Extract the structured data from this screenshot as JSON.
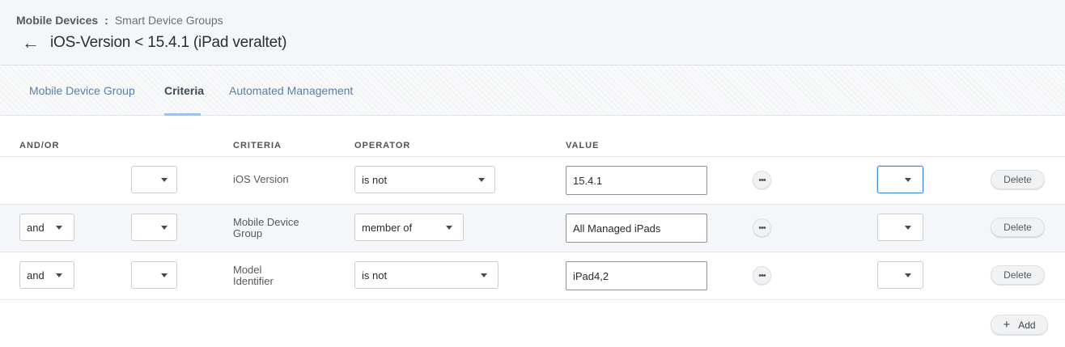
{
  "breadcrumb": {
    "root": "Mobile Devices",
    "separator": ":",
    "leaf": "Smart Device Groups"
  },
  "page": {
    "back_icon": "←",
    "title": "iOS-Version < 15.4.1 (iPad veraltet)"
  },
  "tabs": [
    {
      "label": "Mobile Device Group",
      "active": false
    },
    {
      "label": "Criteria",
      "active": true
    },
    {
      "label": "Automated Management",
      "active": false
    }
  ],
  "table": {
    "headers": {
      "and_or": "AND/OR",
      "criteria": "CRITERIA",
      "operator": "OPERATOR",
      "value": "VALUE"
    },
    "rows": [
      {
        "and_or": "",
        "open_paren": "",
        "criteria": "iOS Version",
        "operator": "is not",
        "value": "15.4.1",
        "close_paren": "",
        "more_icon": "•••",
        "delete_label": "Delete"
      },
      {
        "and_or": "and",
        "open_paren": "",
        "criteria": "Mobile Device Group",
        "operator": "member of",
        "value": "All Managed iPads",
        "close_paren": "",
        "more_icon": "•••",
        "delete_label": "Delete"
      },
      {
        "and_or": "and",
        "open_paren": "",
        "criteria": "Model Identifier",
        "operator": "is not",
        "value": "iPad4,2",
        "close_paren": "",
        "more_icon": "•••",
        "delete_label": "Delete"
      }
    ]
  },
  "add_button": {
    "icon": "+",
    "label": "Add"
  },
  "colors": {
    "tab_link": "#5a7ea8",
    "tab_active_underline": "#9ec2e6",
    "focus_border": "#3f8bd8",
    "row_alt_background": "#f4f6f9"
  }
}
